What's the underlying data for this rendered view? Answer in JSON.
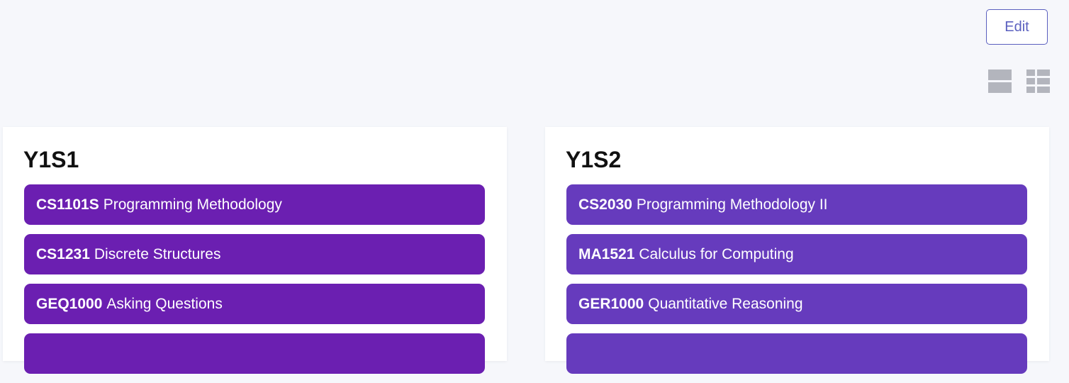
{
  "toolbar": {
    "edit_label": "Edit",
    "view_icons": [
      "list-view-icon",
      "grid-view-icon"
    ],
    "accent_color": "#5a5fbf"
  },
  "semesters": [
    {
      "title": "Y1S1",
      "color": "#6b1fb1",
      "modules": [
        {
          "code": "CS1101S",
          "name": "Programming Methodology"
        },
        {
          "code": "CS1231",
          "name": "Discrete Structures"
        },
        {
          "code": "GEQ1000",
          "name": "Asking Questions"
        },
        {
          "code": "",
          "name": ""
        }
      ]
    },
    {
      "title": "Y1S2",
      "color": "#663bbd",
      "modules": [
        {
          "code": "CS2030",
          "name": "Programming Methodology II"
        },
        {
          "code": "MA1521",
          "name": "Calculus for Computing"
        },
        {
          "code": "GER1000",
          "name": "Quantitative Reasoning"
        },
        {
          "code": "",
          "name": ""
        }
      ]
    }
  ]
}
